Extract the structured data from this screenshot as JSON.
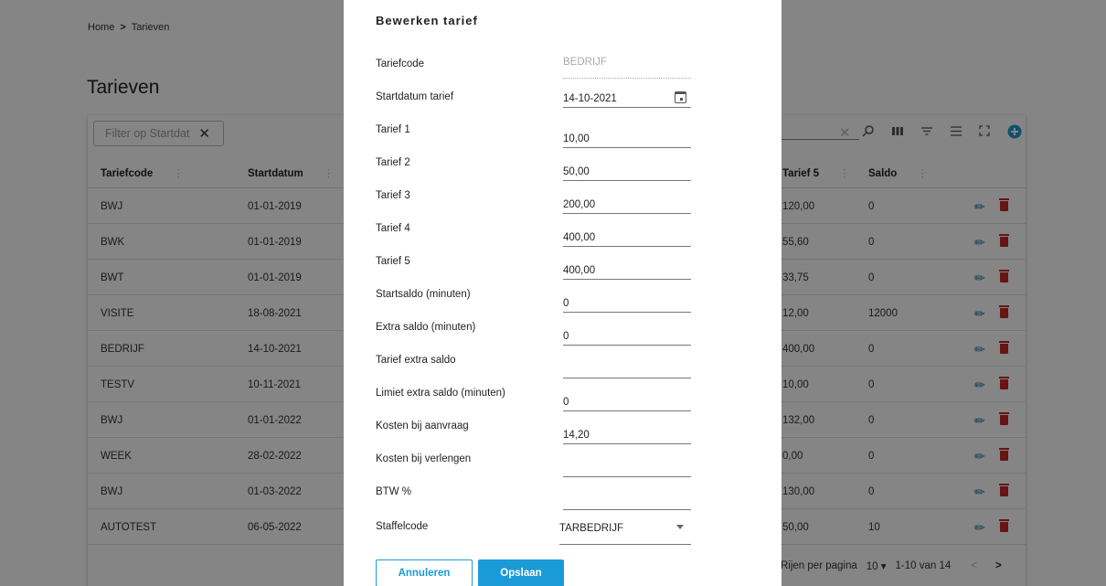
{
  "breadcrumb": {
    "home": "Home",
    "separator": ">",
    "current": "Tarieven"
  },
  "page_title": "Tarieven",
  "filter_chip": {
    "label": "Filter op Startdat",
    "close": "✕"
  },
  "toolbar": {
    "clear": "✕",
    "icons": [
      "search-icon",
      "columns-icon",
      "filter-icon",
      "density-icon",
      "fullscreen-icon",
      "add-icon"
    ]
  },
  "table": {
    "headers": {
      "code": "Tariefcode",
      "start": "Startdatum",
      "t5": "Tarief 5",
      "saldo": "Saldo"
    },
    "rows": [
      {
        "code": "BWJ",
        "start": "01-01-2019",
        "t5": "120,00",
        "saldo": "0"
      },
      {
        "code": "BWK",
        "start": "01-01-2019",
        "t5": "55,60",
        "saldo": "0"
      },
      {
        "code": "BWT",
        "start": "01-01-2019",
        "t5": "33,75",
        "saldo": "0"
      },
      {
        "code": "VISITE",
        "start": "18-08-2021",
        "t5": "12,00",
        "saldo": "12000"
      },
      {
        "code": "BEDRIJF",
        "start": "14-10-2021",
        "t5": "400,00",
        "saldo": "0"
      },
      {
        "code": "TESTV",
        "start": "10-11-2021",
        "t5": "10,00",
        "saldo": "0"
      },
      {
        "code": "BWJ",
        "start": "01-01-2022",
        "t5": "132,00",
        "saldo": "0"
      },
      {
        "code": "WEEK",
        "start": "28-02-2022",
        "t5": "0,00",
        "saldo": "0"
      },
      {
        "code": "BWJ",
        "start": "01-03-2022",
        "t5": "130,00",
        "saldo": "0"
      },
      {
        "code": "AUTOTEST",
        "start": "06-05-2022",
        "t5": "50,00",
        "saldo": "10"
      }
    ]
  },
  "pager": {
    "rows_label": "Rijen per pagina",
    "rows_value": "10 ▾",
    "range": "1-10 van 14",
    "prev": "<",
    "next": ">"
  },
  "modal": {
    "title": "Bewerken tarief",
    "fields": {
      "code": {
        "label": "Tariefcode",
        "value": "BEDRIJF"
      },
      "start": {
        "label": "Startdatum tarief",
        "value": "14-10-2021"
      },
      "t1": {
        "label": "Tarief 1",
        "value": "10,00"
      },
      "t2": {
        "label": "Tarief 2",
        "value": "50,00"
      },
      "t3": {
        "label": "Tarief 3",
        "value": "200,00"
      },
      "t4": {
        "label": "Tarief 4",
        "value": "400,00"
      },
      "t5": {
        "label": "Tarief 5",
        "value": "400,00"
      },
      "startsaldo": {
        "label": "Startsaldo (minuten)",
        "value": "0"
      },
      "extrasaldo": {
        "label": "Extra saldo (minuten)",
        "value": "0"
      },
      "tariefextra": {
        "label": "Tarief extra saldo",
        "value": ""
      },
      "limiet": {
        "label": "Limiet extra saldo (minuten)",
        "value": "0"
      },
      "aanvraag": {
        "label": "Kosten bij aanvraag",
        "value": "14,20"
      },
      "verlengen": {
        "label": "Kosten bij verlengen",
        "value": ""
      },
      "btw": {
        "label": "BTW %",
        "value": ""
      },
      "staffel": {
        "label": "Staffelcode",
        "value": "TARBEDRIJF"
      }
    },
    "cancel_label": "Annuleren",
    "save_label": "Opslaan"
  },
  "colors": {
    "accent": "#1a9bd7",
    "edit": "#0b6e8e",
    "delete": "#c62828"
  }
}
